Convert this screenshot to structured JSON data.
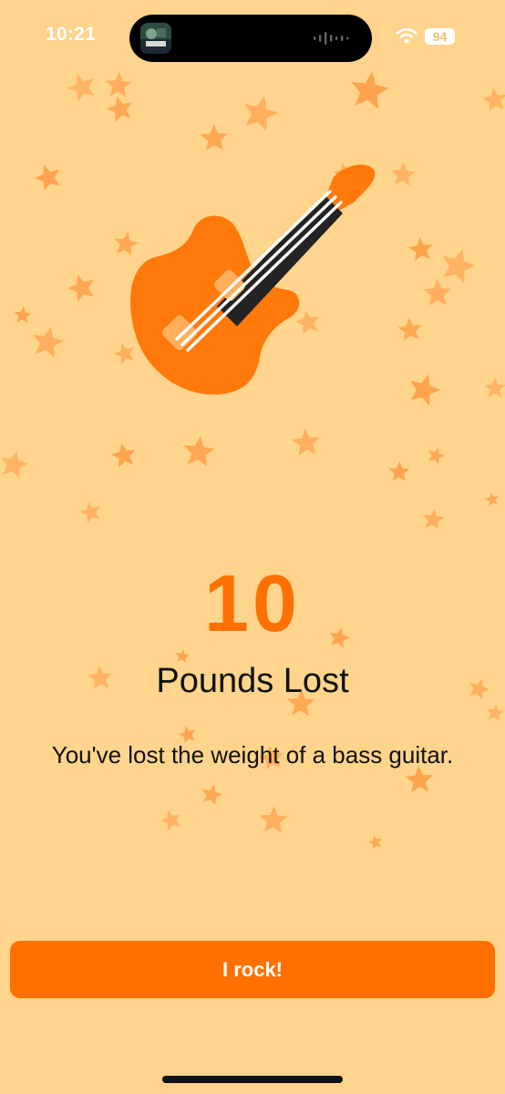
{
  "status_bar": {
    "time": "10:21",
    "battery": "94",
    "icons": [
      "wifi-icon",
      "waveform-icon",
      "app-thumbnail-icon"
    ]
  },
  "achievement": {
    "value": "10",
    "unit": "Pounds Lost",
    "message": "You've lost the weight of a bass guitar.",
    "hero_icon": "bass-guitar-icon"
  },
  "cta": {
    "label": "I rock!"
  },
  "colors": {
    "background": "#FFD48C",
    "accent": "#FF7000",
    "guitar_orange": "#FF7A0A",
    "star": "#FF8E33",
    "text": "#111111",
    "button_text": "#FFFFFF"
  }
}
